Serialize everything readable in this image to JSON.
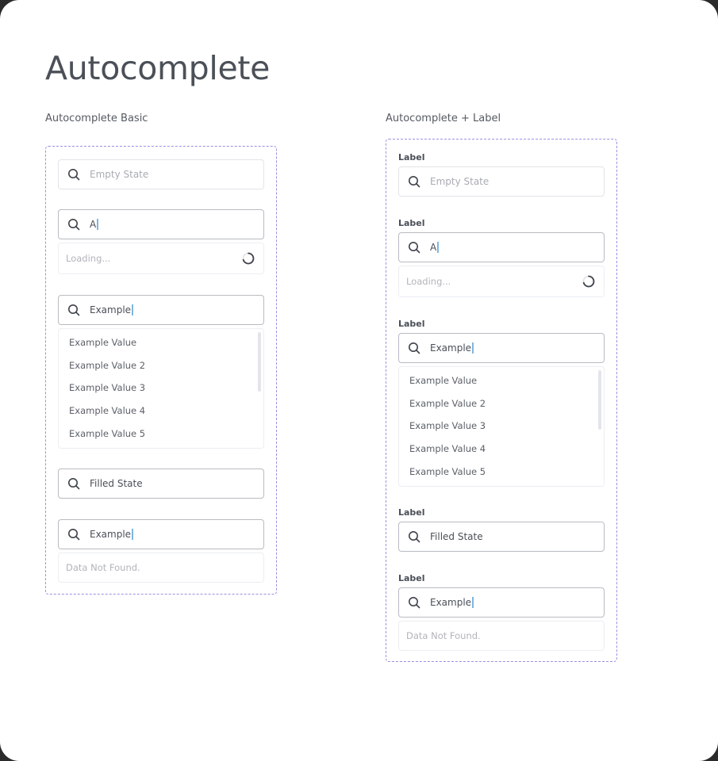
{
  "page": {
    "title": "Autocomplete"
  },
  "icons": {
    "search": "search-icon",
    "spinner": "loading-spinner-icon"
  },
  "colors": {
    "frame_border": "#9d8fe0",
    "caret": "#7fb6de",
    "text": "#4a4f57",
    "placeholder": "#a8acb3"
  },
  "basic": {
    "section_title": "Autocomplete Basic",
    "empty": {
      "placeholder": "Empty State"
    },
    "loading_field": {
      "value": "A",
      "loading_text": "Loading..."
    },
    "list_field": {
      "value": "Example",
      "options": [
        "Example Value",
        "Example Value 2",
        "Example Value 3",
        "Example Value 4",
        "Example Value 5"
      ]
    },
    "filled": {
      "value": "Filled State"
    },
    "notfound_field": {
      "value": "Example",
      "message": "Data Not Found."
    }
  },
  "labeled": {
    "section_title": "Autocomplete + Label",
    "label": "Label",
    "empty": {
      "placeholder": "Empty State"
    },
    "loading_field": {
      "value": "A",
      "loading_text": "Loading..."
    },
    "list_field": {
      "value": "Example",
      "options": [
        "Example Value",
        "Example Value 2",
        "Example Value 3",
        "Example Value 4",
        "Example Value 5"
      ]
    },
    "filled": {
      "value": "Filled State"
    },
    "notfound_field": {
      "value": "Example",
      "message": "Data Not Found."
    }
  }
}
